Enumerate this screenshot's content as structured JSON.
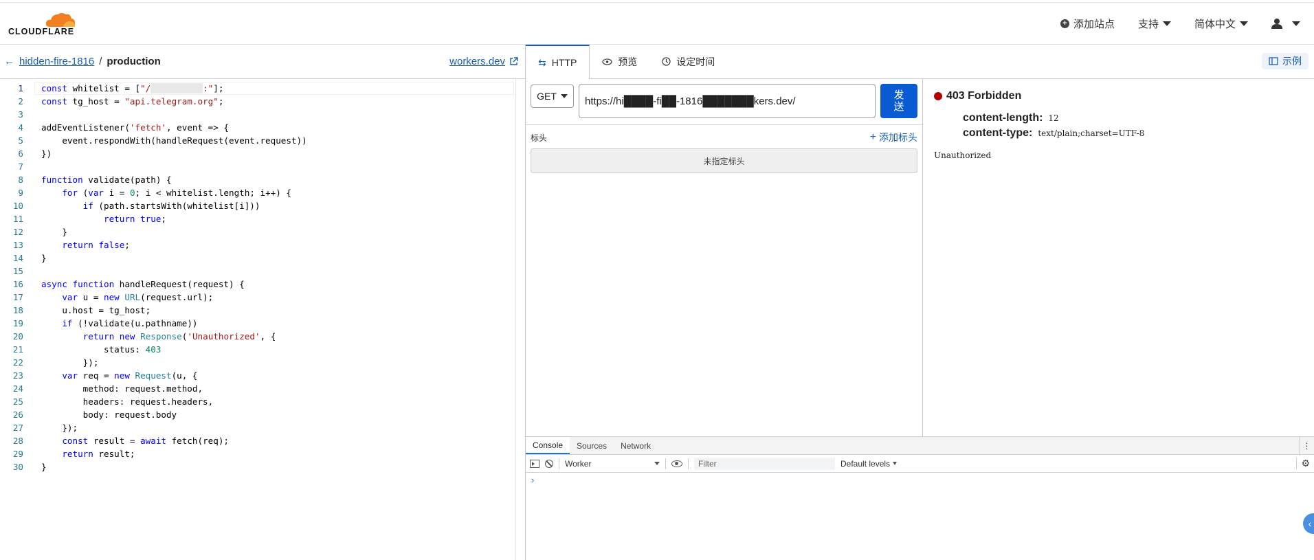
{
  "brand": {
    "logo_text": "CLOUDFLARE"
  },
  "topnav": {
    "add_site": "添加站点",
    "support": "支持",
    "language": "简体中文"
  },
  "breadcrumb": {
    "worker_name": "hidden-fire-1816",
    "separator": "/",
    "environment": "production",
    "workers_link": "workers.dev"
  },
  "editor": {
    "lines": [
      "const whitelist = [\"/██████████:\"];",
      "const tg_host = \"api.telegram.org\";",
      "",
      "addEventListener('fetch', event => {",
      "    event.respondWith(handleRequest(event.request))",
      "})",
      "",
      "function validate(path) {",
      "    for (var i = 0; i < whitelist.length; i++) {",
      "        if (path.startsWith(whitelist[i]))",
      "            return true;",
      "    }",
      "    return false;",
      "}",
      "",
      "async function handleRequest(request) {",
      "    var u = new URL(request.url);",
      "    u.host = tg_host;",
      "    if (!validate(u.pathname))",
      "        return new Response('Unauthorized', {",
      "            status: 403",
      "        });",
      "    var req = new Request(u, {",
      "        method: request.method,",
      "        headers: request.headers,",
      "        body: request.body",
      "    });",
      "    const result = await fetch(req);",
      "    return result;",
      "}"
    ]
  },
  "tabs": {
    "http": "HTTP",
    "preview": "预览",
    "schedule": "设定时间",
    "example": "示例"
  },
  "request": {
    "method": "GET",
    "url": "https://hi████-fi██-1816███████kers.dev/",
    "send_label": "发送",
    "headers_label": "标头",
    "add_header_label": "添加标头",
    "no_headers": "未指定标头"
  },
  "response": {
    "status": "403 Forbidden",
    "status_color": "#b30000",
    "headers": [
      {
        "key": "content-length:",
        "value": "12"
      },
      {
        "key": "content-type:",
        "value": "text/plain;charset=UTF-8"
      }
    ],
    "body": "Unauthorized"
  },
  "devtools": {
    "tabs": [
      "Console",
      "Sources",
      "Network"
    ],
    "context": "Worker",
    "filter_placeholder": "Filter",
    "levels": "Default levels",
    "prompt": "›"
  },
  "colors": {
    "accent": "#1a5fb4",
    "send_button": "#0a5ad4",
    "logo_orange": "#f38020"
  }
}
